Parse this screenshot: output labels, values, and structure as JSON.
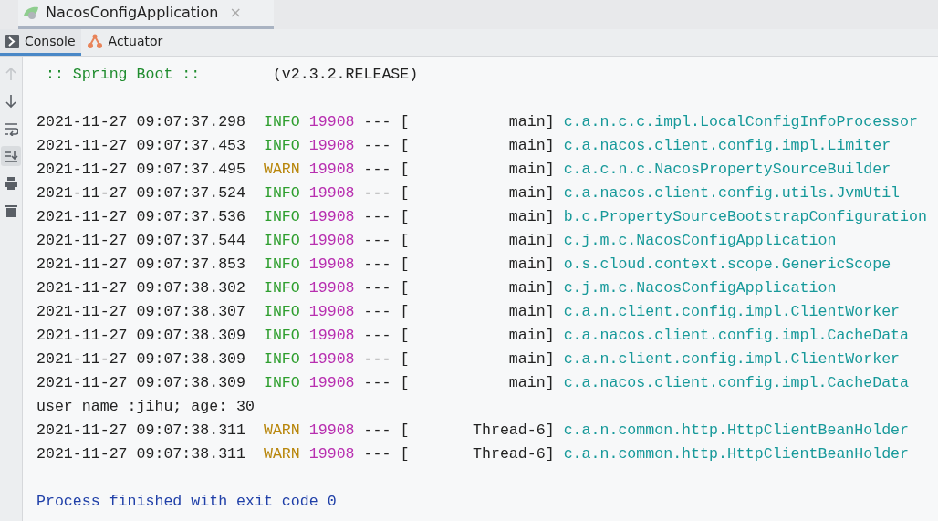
{
  "editor_tab": {
    "title": "NacosConfigApplication",
    "close": "×"
  },
  "tool_tabs": [
    {
      "label": "Console",
      "selected": true,
      "kind": "console"
    },
    {
      "label": "Actuator",
      "selected": false,
      "kind": "actuator"
    }
  ],
  "gutter": [
    {
      "kind": "up",
      "disabled": true
    },
    {
      "kind": "down",
      "disabled": false
    },
    {
      "kind": "wrap",
      "disabled": false
    },
    {
      "kind": "scroll-end",
      "disabled": false,
      "selected": true
    },
    {
      "kind": "print",
      "disabled": false
    },
    {
      "kind": "trash",
      "disabled": false
    }
  ],
  "lines": [
    {
      "kind": "banner",
      "label": " :: Spring Boot :: ",
      "version": "       (v2.3.2.RELEASE)"
    },
    {
      "kind": "log",
      "time": "2021-11-27 09:07:37.298",
      "level": " INFO",
      "color": "#2e9e2e",
      "pid": "19908",
      "separator": "---",
      "thread": "[           main]",
      "logger": "c.a.n.c.c.impl.LocalConfigInfoProcessor"
    },
    {
      "kind": "log",
      "time": "2021-11-27 09:07:37.453",
      "level": " INFO",
      "color": "#2e9e2e",
      "pid": "19908",
      "separator": "---",
      "thread": "[           main]",
      "logger": "c.a.nacos.client.config.impl.Limiter"
    },
    {
      "kind": "log",
      "time": "2021-11-27 09:07:37.495",
      "level": " WARN",
      "color": "#b8860b",
      "pid": "19908",
      "separator": "---",
      "thread": "[           main]",
      "logger": "c.a.c.n.c.NacosPropertySourceBuilder"
    },
    {
      "kind": "log",
      "time": "2021-11-27 09:07:37.524",
      "level": " INFO",
      "color": "#2e9e2e",
      "pid": "19908",
      "separator": "---",
      "thread": "[           main]",
      "logger": "c.a.nacos.client.config.utils.JvmUtil"
    },
    {
      "kind": "log",
      "time": "2021-11-27 09:07:37.536",
      "level": " INFO",
      "color": "#2e9e2e",
      "pid": "19908",
      "separator": "---",
      "thread": "[           main]",
      "logger": "b.c.PropertySourceBootstrapConfiguration"
    },
    {
      "kind": "log",
      "time": "2021-11-27 09:07:37.544",
      "level": " INFO",
      "color": "#2e9e2e",
      "pid": "19908",
      "separator": "---",
      "thread": "[           main]",
      "logger": "c.j.m.c.NacosConfigApplication"
    },
    {
      "kind": "log",
      "time": "2021-11-27 09:07:37.853",
      "level": " INFO",
      "color": "#2e9e2e",
      "pid": "19908",
      "separator": "---",
      "thread": "[           main]",
      "logger": "o.s.cloud.context.scope.GenericScope"
    },
    {
      "kind": "log",
      "time": "2021-11-27 09:07:38.302",
      "level": " INFO",
      "color": "#2e9e2e",
      "pid": "19908",
      "separator": "---",
      "thread": "[           main]",
      "logger": "c.j.m.c.NacosConfigApplication"
    },
    {
      "kind": "log",
      "time": "2021-11-27 09:07:38.307",
      "level": " INFO",
      "color": "#2e9e2e",
      "pid": "19908",
      "separator": "---",
      "thread": "[           main]",
      "logger": "c.a.n.client.config.impl.ClientWorker"
    },
    {
      "kind": "log",
      "time": "2021-11-27 09:07:38.309",
      "level": " INFO",
      "color": "#2e9e2e",
      "pid": "19908",
      "separator": "---",
      "thread": "[           main]",
      "logger": "c.a.nacos.client.config.impl.CacheData"
    },
    {
      "kind": "log",
      "time": "2021-11-27 09:07:38.309",
      "level": " INFO",
      "color": "#2e9e2e",
      "pid": "19908",
      "separator": "---",
      "thread": "[           main]",
      "logger": "c.a.n.client.config.impl.ClientWorker"
    },
    {
      "kind": "log",
      "time": "2021-11-27 09:07:38.309",
      "level": " INFO",
      "color": "#2e9e2e",
      "pid": "19908",
      "separator": "---",
      "thread": "[           main]",
      "logger": "c.a.nacos.client.config.impl.CacheData"
    },
    {
      "kind": "plain",
      "text": "user name :jihu; age: 30"
    },
    {
      "kind": "log",
      "time": "2021-11-27 09:07:38.311",
      "level": " WARN",
      "color": "#b8860b",
      "pid": "19908",
      "separator": "---",
      "thread": "[       Thread-6]",
      "logger": "c.a.n.common.http.HttpClientBeanHolder"
    },
    {
      "kind": "log",
      "time": "2021-11-27 09:07:38.311",
      "level": " WARN",
      "color": "#b8860b",
      "pid": "19908",
      "separator": "---",
      "thread": "[       Thread-6]",
      "logger": "c.a.n.common.http.HttpClientBeanHolder"
    },
    {
      "kind": "exit",
      "text": "Process finished with exit code 0"
    }
  ]
}
